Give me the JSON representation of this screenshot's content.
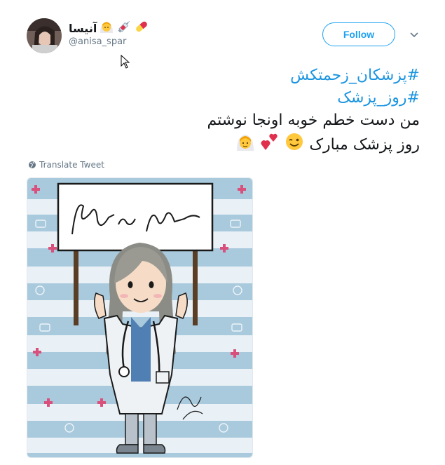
{
  "user": {
    "display_name": "آنیسا",
    "handle": "@anisa_spar",
    "avatar_icon": "avatar-photo"
  },
  "actions": {
    "follow_label": "Follow",
    "caret_icon": "chevron-down-icon"
  },
  "tweet": {
    "lines": [
      "#پزشکان_زحمتکش",
      "#روز_پزشک",
      "من دست خطم خوبه اونجا نوشتم",
      "روز پزشک مبارک"
    ],
    "translate_label": "Translate Tweet"
  },
  "colors": {
    "accent": "#1da1f2",
    "hashtag": "#1b95e0",
    "muted": "#657786",
    "stripe_blue": "#a9c9dd",
    "stripe_white": "#e9f1f6",
    "cross": "#d9507c"
  }
}
